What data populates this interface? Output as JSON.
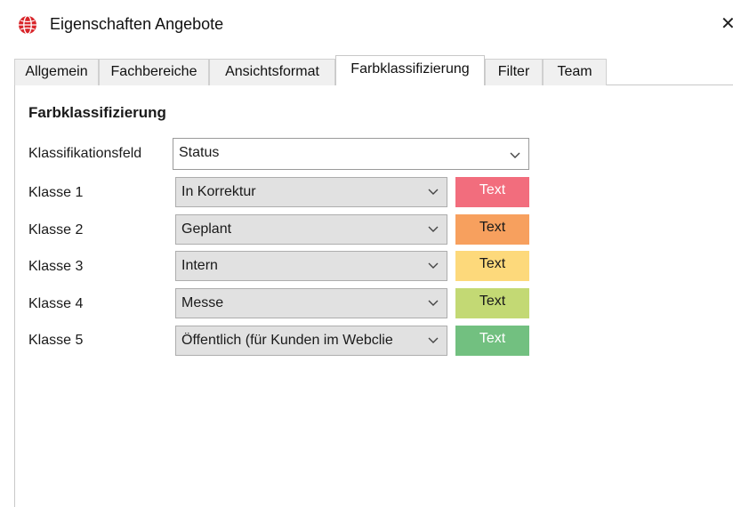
{
  "window": {
    "title": "Eigenschaften Angebote",
    "app_icon": "globe-icon",
    "close_glyph": "✕"
  },
  "tabs": [
    {
      "label": "Allgemein",
      "active": false
    },
    {
      "label": "Fachbereiche",
      "active": false
    },
    {
      "label": "Ansichtsformat",
      "active": false
    },
    {
      "label": "Farbklassifizierung",
      "active": true
    },
    {
      "label": "Filter",
      "active": false
    },
    {
      "label": "Team",
      "active": false
    }
  ],
  "section": {
    "title": "Farbklassifizierung",
    "field_label": "Klassifikationsfeld",
    "field_value": "Status"
  },
  "classes": [
    {
      "label": "Klasse 1",
      "value": "In Korrektur",
      "swatch_text": "Text",
      "bg": "#f26d7d",
      "fg": "#ffffff"
    },
    {
      "label": "Klasse 2",
      "value": "Geplant",
      "swatch_text": "Text",
      "bg": "#f7a05e",
      "fg": "#1a1a1a"
    },
    {
      "label": "Klasse 3",
      "value": "Intern",
      "swatch_text": "Text",
      "bg": "#fdd97b",
      "fg": "#1a1a1a"
    },
    {
      "label": "Klasse 4",
      "value": "Messe",
      "swatch_text": "Text",
      "bg": "#c3d974",
      "fg": "#1a1a1a"
    },
    {
      "label": "Klasse 5",
      "value": "Öffentlich (für Kunden im Webclie",
      "swatch_text": "Text",
      "bg": "#72c080",
      "fg": "#ffffff"
    }
  ],
  "colors": {
    "tab_bg": "#f0f0f0",
    "combo_bg": "#e1e1e1",
    "border": "#c8c8c8"
  }
}
